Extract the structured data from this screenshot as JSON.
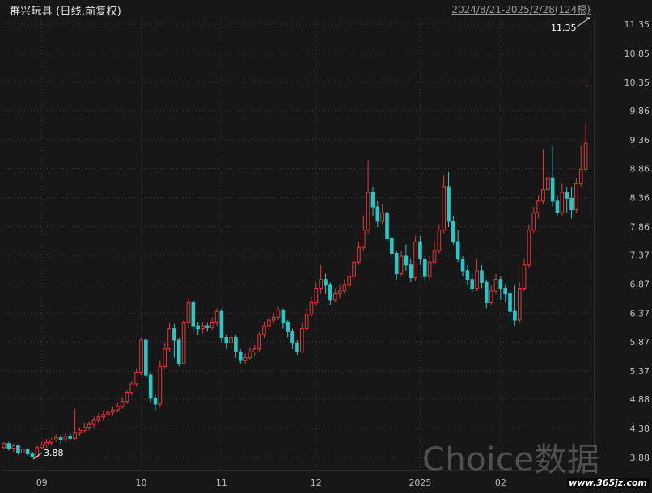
{
  "header": {
    "title": "群兴玩具 (日线,前复权)",
    "range": "2024/8/21-2025/2/28(124根)"
  },
  "watermark": {
    "brand": "Choice数据",
    "url": "www.365jz.com"
  },
  "colors": {
    "background": "#171717",
    "grid": "#3a3a3a",
    "up": "#e03a3a",
    "down": "#29c7c7",
    "axis_text": "#bdbdbd"
  },
  "chart_data": {
    "type": "candlestick",
    "ylim": [
      3.7,
      11.6
    ],
    "y_ticks": [
      "11.35",
      "10.85",
      "10.35",
      "9.86",
      "9.36",
      "8.86",
      "8.36",
      "7.86",
      "7.37",
      "6.87",
      "6.37",
      "5.87",
      "5.37",
      "4.88",
      "4.38",
      "3.88"
    ],
    "x_ticks": [
      "09",
      "10",
      "11",
      "12",
      "2025",
      "02"
    ],
    "x_tick_index": [
      8,
      29,
      46,
      66,
      88,
      105
    ],
    "high_label": "11.35",
    "low_label": "3.88",
    "high_marker": 11.35,
    "low_marker": 3.88,
    "candles": [
      [
        4.05,
        4.12,
        4.14,
        4.02
      ],
      [
        4.12,
        4.04,
        4.15,
        4.0
      ],
      [
        4.04,
        4.08,
        4.12,
        3.98
      ],
      [
        4.08,
        3.96,
        4.1,
        3.93
      ],
      [
        3.96,
        4.02,
        4.06,
        3.92
      ],
      [
        4.02,
        3.94,
        4.05,
        3.9
      ],
      [
        3.94,
        3.9,
        3.98,
        3.88
      ],
      [
        3.9,
        4.05,
        4.08,
        3.89
      ],
      [
        4.05,
        4.1,
        4.15,
        4.02
      ],
      [
        4.1,
        4.14,
        4.2,
        4.05
      ],
      [
        4.14,
        4.18,
        4.22,
        4.1
      ],
      [
        4.18,
        4.22,
        4.28,
        4.15
      ],
      [
        4.22,
        4.18,
        4.26,
        4.12
      ],
      [
        4.18,
        4.25,
        4.3,
        4.15
      ],
      [
        4.25,
        4.21,
        4.3,
        4.18
      ],
      [
        4.21,
        4.3,
        4.72,
        4.18
      ],
      [
        4.3,
        4.35,
        4.4,
        4.25
      ],
      [
        4.35,
        4.4,
        4.48,
        4.3
      ],
      [
        4.4,
        4.45,
        4.5,
        4.35
      ],
      [
        4.45,
        4.52,
        4.58,
        4.4
      ],
      [
        4.52,
        4.58,
        4.65,
        4.48
      ],
      [
        4.58,
        4.62,
        4.68,
        4.52
      ],
      [
        4.62,
        4.66,
        4.72,
        4.58
      ],
      [
        4.66,
        4.7,
        4.76,
        4.6
      ],
      [
        4.7,
        4.76,
        4.82,
        4.66
      ],
      [
        4.76,
        4.85,
        4.92,
        4.72
      ],
      [
        4.85,
        5.0,
        5.05,
        4.8
      ],
      [
        5.0,
        5.15,
        5.2,
        4.95
      ],
      [
        5.15,
        5.35,
        5.42,
        5.1
      ],
      [
        5.35,
        5.9,
        5.95,
        5.3
      ],
      [
        5.9,
        5.3,
        5.95,
        5.25
      ],
      [
        5.3,
        4.9,
        5.35,
        4.82
      ],
      [
        4.9,
        4.8,
        4.95,
        4.7
      ],
      [
        4.8,
        5.45,
        5.55,
        4.75
      ],
      [
        5.45,
        5.75,
        5.85,
        5.4
      ],
      [
        5.75,
        6.1,
        6.2,
        5.7
      ],
      [
        6.1,
        5.9,
        6.18,
        5.6
      ],
      [
        5.9,
        5.5,
        5.95,
        5.45
      ],
      [
        5.5,
        6.2,
        6.25,
        5.48
      ],
      [
        6.2,
        6.55,
        6.62,
        6.1
      ],
      [
        6.55,
        6.15,
        6.6,
        6.05
      ],
      [
        6.15,
        6.1,
        6.22,
        6.0
      ],
      [
        6.1,
        6.15,
        6.22,
        6.02
      ],
      [
        6.15,
        6.12,
        6.2,
        6.05
      ],
      [
        6.12,
        6.2,
        6.28,
        6.08
      ],
      [
        6.2,
        6.4,
        6.45,
        6.15
      ],
      [
        6.4,
        5.95,
        6.45,
        5.85
      ],
      [
        5.95,
        5.85,
        6.0,
        5.75
      ],
      [
        5.85,
        5.95,
        6.05,
        5.8
      ],
      [
        5.95,
        5.7,
        6.0,
        5.6
      ],
      [
        5.7,
        5.55,
        5.75,
        5.5
      ],
      [
        5.55,
        5.6,
        5.68,
        5.5
      ],
      [
        5.6,
        5.7,
        5.78,
        5.55
      ],
      [
        5.7,
        5.75,
        5.82,
        5.62
      ],
      [
        5.75,
        6.0,
        6.05,
        5.7
      ],
      [
        6.0,
        6.15,
        6.22,
        5.95
      ],
      [
        6.15,
        6.25,
        6.32,
        6.1
      ],
      [
        6.25,
        6.3,
        6.38,
        6.18
      ],
      [
        6.3,
        6.42,
        6.48,
        6.25
      ],
      [
        6.42,
        6.2,
        6.45,
        6.1
      ],
      [
        6.2,
        6.05,
        6.25,
        5.95
      ],
      [
        6.05,
        5.85,
        6.1,
        5.75
      ],
      [
        5.85,
        5.7,
        5.9,
        5.65
      ],
      [
        5.7,
        6.1,
        6.2,
        5.68
      ],
      [
        6.1,
        6.35,
        6.45,
        6.05
      ],
      [
        6.35,
        6.55,
        6.65,
        6.3
      ],
      [
        6.55,
        6.8,
        6.9,
        6.5
      ],
      [
        6.8,
        6.95,
        7.2,
        6.7
      ],
      [
        6.95,
        6.85,
        7.05,
        6.7
      ],
      [
        6.85,
        6.6,
        6.9,
        6.5
      ],
      [
        6.6,
        6.7,
        6.8,
        6.55
      ],
      [
        6.7,
        6.75,
        6.85,
        6.62
      ],
      [
        6.75,
        6.85,
        6.95,
        6.7
      ],
      [
        6.85,
        7.0,
        7.1,
        6.8
      ],
      [
        7.0,
        7.25,
        7.4,
        6.95
      ],
      [
        7.25,
        7.5,
        7.6,
        7.2
      ],
      [
        7.5,
        7.8,
        8.05,
        7.45
      ],
      [
        7.8,
        8.45,
        9.0,
        7.75
      ],
      [
        8.45,
        8.2,
        8.55,
        8.05
      ],
      [
        8.2,
        7.95,
        8.3,
        7.85
      ],
      [
        7.95,
        8.1,
        8.25,
        7.9
      ],
      [
        8.1,
        7.65,
        8.15,
        7.55
      ],
      [
        7.65,
        7.4,
        7.7,
        7.3
      ],
      [
        7.4,
        7.05,
        7.45,
        6.95
      ],
      [
        7.05,
        7.35,
        7.45,
        7.0
      ],
      [
        7.35,
        7.2,
        7.55,
        7.1
      ],
      [
        7.2,
        6.98,
        7.3,
        6.9
      ],
      [
        6.98,
        7.6,
        7.7,
        6.92
      ],
      [
        7.6,
        7.3,
        7.7,
        7.2
      ],
      [
        7.3,
        7.0,
        7.35,
        6.92
      ],
      [
        7.0,
        7.25,
        7.35,
        6.95
      ],
      [
        7.25,
        7.45,
        7.6,
        7.2
      ],
      [
        7.45,
        7.8,
        7.9,
        7.4
      ],
      [
        7.8,
        8.55,
        8.75,
        7.75
      ],
      [
        8.55,
        7.95,
        8.8,
        7.85
      ],
      [
        7.95,
        7.6,
        8.05,
        7.55
      ],
      [
        7.6,
        7.3,
        7.8,
        7.25
      ],
      [
        7.3,
        7.1,
        7.35,
        7.0
      ],
      [
        7.1,
        6.95,
        7.2,
        6.85
      ],
      [
        6.95,
        6.8,
        7.05,
        6.72
      ],
      [
        6.8,
        7.1,
        7.3,
        6.75
      ],
      [
        7.1,
        6.9,
        7.2,
        6.8
      ],
      [
        6.9,
        6.55,
        6.95,
        6.45
      ],
      [
        6.55,
        6.75,
        6.85,
        6.5
      ],
      [
        6.75,
        6.95,
        7.05,
        6.7
      ],
      [
        6.95,
        6.8,
        7.0,
        6.6
      ],
      [
        6.8,
        6.7,
        6.85,
        6.55
      ],
      [
        6.7,
        6.4,
        6.75,
        6.2
      ],
      [
        6.4,
        6.25,
        6.85,
        6.15
      ],
      [
        6.25,
        6.8,
        6.9,
        6.2
      ],
      [
        6.8,
        7.2,
        7.3,
        6.75
      ],
      [
        7.2,
        7.8,
        7.9,
        7.15
      ],
      [
        7.8,
        8.1,
        8.2,
        7.75
      ],
      [
        8.1,
        8.3,
        8.4,
        8.0
      ],
      [
        8.3,
        8.5,
        9.2,
        8.25
      ],
      [
        8.5,
        8.7,
        8.8,
        8.4
      ],
      [
        8.7,
        8.3,
        9.25,
        8.2
      ],
      [
        8.3,
        8.1,
        8.4,
        8.05
      ],
      [
        8.1,
        8.45,
        8.6,
        8.05
      ],
      [
        8.45,
        8.35,
        8.55,
        8.1
      ],
      [
        8.35,
        8.15,
        8.55,
        8.0
      ],
      [
        8.15,
        8.6,
        8.7,
        8.1
      ],
      [
        8.6,
        8.85,
        9.25,
        8.55
      ],
      [
        8.85,
        9.3,
        9.65,
        8.8
      ]
    ]
  }
}
